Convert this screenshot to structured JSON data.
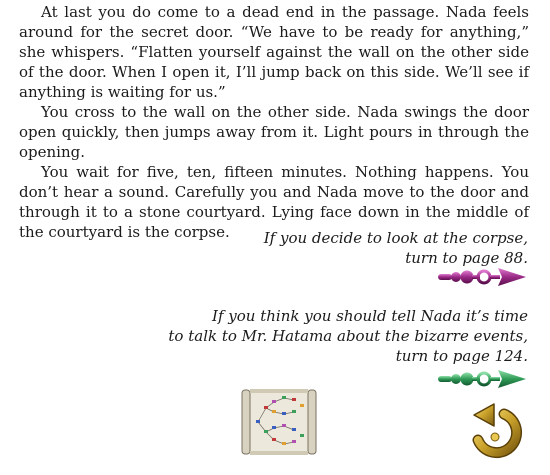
{
  "story": {
    "paragraphs": [
      "At last you do come to a dead end in the passage. Nada feels around for the secret door. “We have to be ready for anything,” she whispers. “Flatten yourself against the wall on the other side of the door. When I open it, I’ll jump back on this side. We’ll see if anything is waiting for us.”",
      "You cross to the wall on the other side. Nada swings the door open quickly, then jumps away from it. Light pours in through the opening.",
      "You wait for five, ten, fifteen minutes. Nothing happens. You don’t hear a sound. Carefully you and Nada move to the door and through it to a stone courtyard. Lying face down in the middle of the courtyard is the corpse."
    ]
  },
  "choices": [
    {
      "lines": [
        "If you decide to look at the corpse,"
      ],
      "turn": "turn to page 88.",
      "arrow_icon": "purple-arrow-icon",
      "arrow_color": "#9a2a86"
    },
    {
      "lines": [
        "If you think you should tell Nada it’s time",
        "to talk to Mr. Hatama about the bizarre events,"
      ],
      "turn": "turn to page 124.",
      "arrow_icon": "green-arrow-icon",
      "arrow_color": "#2f9a57"
    }
  ],
  "controls": {
    "map_icon": "story-map-scroll-icon",
    "back_icon": "go-back-arrow-icon",
    "back_color": "#c9a12a"
  }
}
